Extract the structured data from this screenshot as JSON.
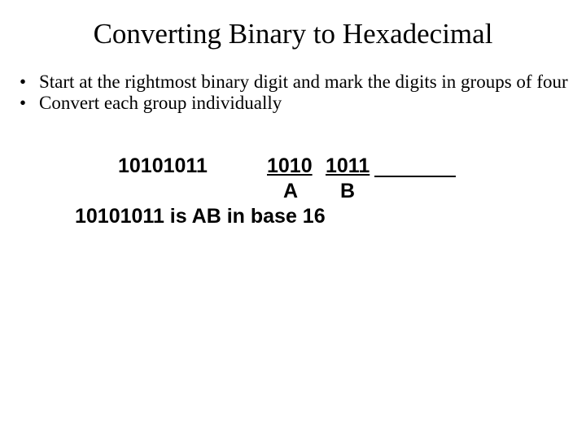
{
  "title": "Converting Binary to Hexadecimal",
  "bullets": [
    "Start at the rightmost binary digit and mark the digits in groups of four",
    "Convert each group individually"
  ],
  "bullet_glyph": "•",
  "example": {
    "binary_full": "10101011",
    "group1": "1010",
    "group2": "1011",
    "hex1": "A",
    "hex2": "B",
    "result_line": "10101011 is AB in base 16"
  }
}
